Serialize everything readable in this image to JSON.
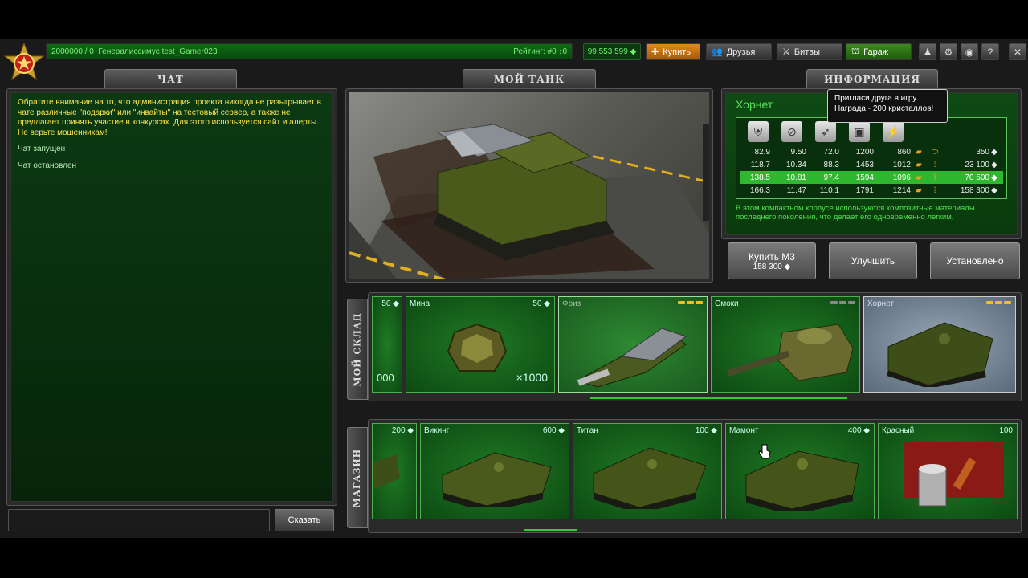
{
  "topbar": {
    "xp_text": "2000000 / 0",
    "rank_name": "Генералиссимус",
    "player_name": "test_Gamer023",
    "rating_text": "Рейтинг: #0",
    "rating_delta": "↕0",
    "crystals": "99 553 599",
    "buy_label": "Купить",
    "friends_label": "Друзья",
    "battles_label": "Битвы",
    "garage_label": "Гараж"
  },
  "tabs": {
    "chat": "ЧАТ",
    "my_tank": "МОЙ ТАНК",
    "info": "ИНФОРМАЦИЯ",
    "warehouse": "МОЙ СКЛАД",
    "shop": "МАГАЗИН"
  },
  "chat": {
    "warning": "Обратите внимание на то, что администрация проекта никогда не разыгрывает в чате различные \"подарки\" или \"инвайты\" на тестовый сервер, а также не предлагает принять участие в конкурсах. Для этого используется сайт и алерты. Не верьте мошенникам!",
    "system1": "Чат запущен",
    "system2": "Чат остановлен",
    "send_label": "Сказать"
  },
  "tooltip": {
    "line1": "Пригласи друга в игру.",
    "line2": "Награда - 200 кристаллов!"
  },
  "info": {
    "title": "Хорнет",
    "rows": [
      {
        "a": "82.9",
        "b": "9.50",
        "c": "72.0",
        "d": "1200",
        "e": "860",
        "price": "350",
        "selected": false
      },
      {
        "a": "118.7",
        "b": "10.34",
        "c": "88.3",
        "d": "1453",
        "e": "1012",
        "price": "23 100",
        "selected": false
      },
      {
        "a": "138.5",
        "b": "10.81",
        "c": "97.4",
        "d": "1594",
        "e": "1096",
        "price": "70 500",
        "selected": true
      },
      {
        "a": "166.3",
        "b": "11.47",
        "c": "110.1",
        "d": "1791",
        "e": "1214",
        "price": "158 300",
        "selected": false
      }
    ],
    "description": "В этом компактном корпусе используются композитные материалы последнего поколения, что делает его одновременно легким,"
  },
  "actions": {
    "buy_m3": "Купить М3",
    "buy_m3_price": "158 300",
    "upgrade": "Улучшить",
    "installed": "Установлено"
  },
  "warehouse": {
    "partial_price": "50",
    "partial_count": "000",
    "items": [
      {
        "name": "Мина",
        "price": "50",
        "count": "×1000"
      },
      {
        "name": "Фриз"
      },
      {
        "name": "Смоки"
      },
      {
        "name": "Хорнет"
      }
    ]
  },
  "shop": {
    "partial_price": "200",
    "items": [
      {
        "name": "Викинг",
        "price": "600"
      },
      {
        "name": "Титан",
        "price": "100"
      },
      {
        "name": "Мамонт",
        "price": "400"
      },
      {
        "name": "Красный",
        "price": "100"
      }
    ]
  },
  "colors": {
    "accent_green": "#2fb82f",
    "chat_text": "#ffe54d",
    "bar_gold": "#f0c020",
    "bar_dim": "#888888"
  }
}
